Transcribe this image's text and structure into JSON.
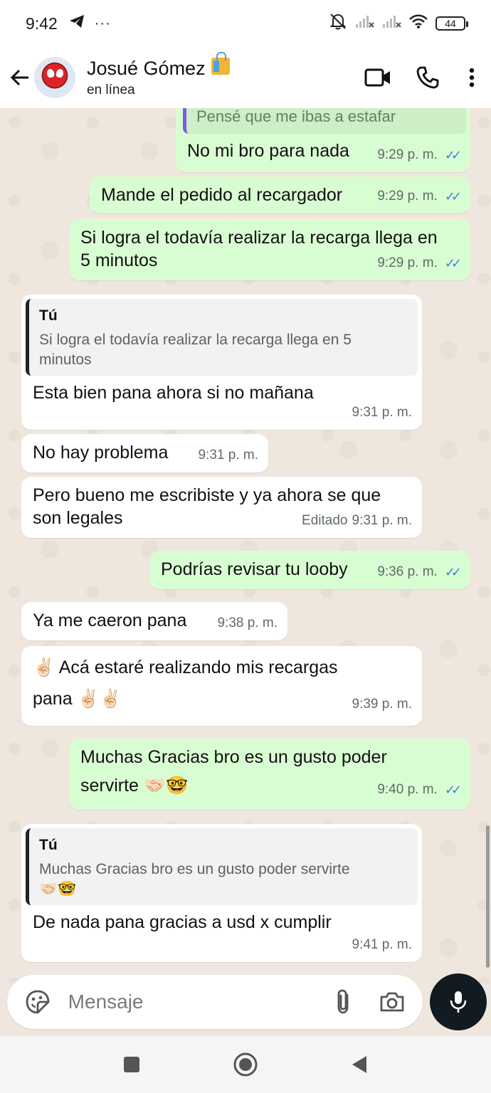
{
  "status_bar": {
    "time": "9:42",
    "more": "···",
    "battery": "44"
  },
  "header": {
    "name": "Josué Gómez",
    "status": "en línea"
  },
  "messages": [
    {
      "direction": "out",
      "quote_text": "Pensé que me ibas a estafar",
      "text": "No mi bro para nada",
      "time": "9:29 p. m."
    },
    {
      "direction": "out",
      "text": "Mande el pedido al recargador",
      "time": "9:29 p. m."
    },
    {
      "direction": "out",
      "text": "Si logra el todavía realizar la recarga llega en 5 minutos",
      "time": "9:29 p. m."
    },
    {
      "direction": "in",
      "quote_name": "Tú",
      "quote_text": "Si logra el todavía realizar la recarga llega en 5 minutos",
      "text": "Esta bien pana ahora si no mañana",
      "time": "9:31 p. m."
    },
    {
      "direction": "in",
      "text": "No hay problema",
      "time": "9:31 p. m."
    },
    {
      "direction": "in",
      "text": "Pero bueno me escribiste y ya ahora se que son legales",
      "edited": "Editado",
      "time": "9:31 p. m."
    },
    {
      "direction": "out",
      "text": "Podrías revisar tu looby",
      "time": "9:36 p. m."
    },
    {
      "direction": "in",
      "text": "Ya me caeron pana",
      "time": "9:38 p. m."
    },
    {
      "direction": "in",
      "text_a": "✌🏻 Acá estaré realizando mis recargas",
      "text_b": "pana ✌🏻✌🏻",
      "time": "9:39 p. m."
    },
    {
      "direction": "out",
      "text_a": "Muchas Gracias bro es un gusto poder",
      "text_b": "servirte 🤝🏻🤓",
      "time": "9:40 p. m."
    },
    {
      "direction": "in",
      "quote_name": "Tú",
      "quote_text_a": "Muchas Gracias bro es un gusto poder servirte",
      "quote_text_b": "🤝🏻🤓",
      "text": "De nada pana gracias a usd x cumplir",
      "time": "9:41 p. m."
    }
  ],
  "input": {
    "placeholder": "Mensaje"
  },
  "colors": {
    "outgoing_bubble": "#d9fdd3",
    "incoming_bubble": "#ffffff",
    "read_ticks": "#3b82d6",
    "chat_bg": "#efe7dd"
  }
}
